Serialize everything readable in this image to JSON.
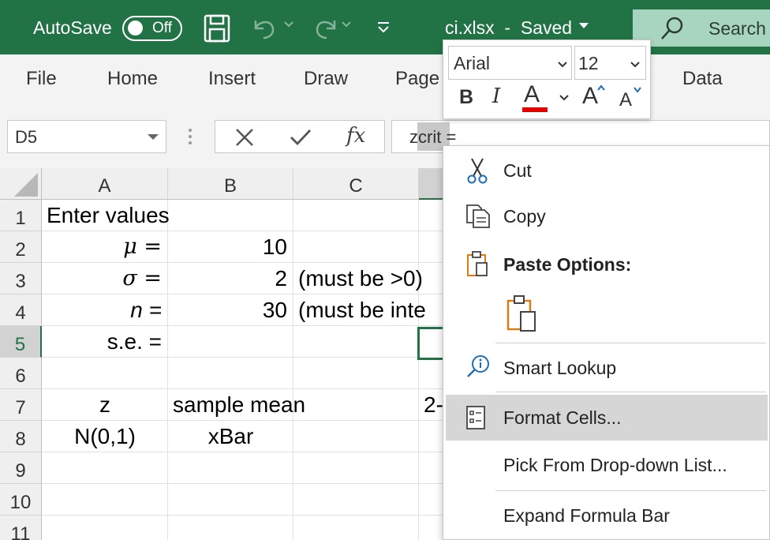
{
  "titlebar": {
    "autosave_label": "AutoSave",
    "autosave_state": "Off",
    "doc_title": "ci.xlsx  -  Saved",
    "search_label": "Search"
  },
  "ribbon": {
    "tabs": [
      "File",
      "Home",
      "Insert",
      "Draw",
      "Page",
      "Data"
    ]
  },
  "formula_bar": {
    "name_box": "D5",
    "fx_label": "fx",
    "formula": "zcrit ="
  },
  "grid": {
    "columns": [
      "A",
      "B",
      "C"
    ],
    "rows": [
      "1",
      "2",
      "3",
      "4",
      "5",
      "6",
      "7",
      "8",
      "9",
      "10",
      "11"
    ],
    "cells": {
      "A1": "Enter values",
      "A2": "μ =",
      "B2": "10",
      "A3": "σ =",
      "B3": "2",
      "C3": "(must be >0)",
      "A4": "n =",
      "B4": "30",
      "C4": "(must be inte",
      "A5": "s.e. =",
      "A7": "z",
      "B7": "sample mean",
      "D7": "2-",
      "A8": "N(0,1)",
      "B8": "xBar"
    }
  },
  "mini_toolbar": {
    "font_name": "Arial",
    "font_size": "12",
    "bold": "B",
    "italic": "I",
    "font_color": "A",
    "grow": "A",
    "shrink": "A",
    "font_color_value": "#e00000"
  },
  "context_menu": {
    "cut": "Cut",
    "copy": "Copy",
    "paste_options": "Paste Options:",
    "smart_lookup": "Smart Lookup",
    "format_cells": "Format Cells...",
    "pick_list": "Pick From Drop-down List...",
    "expand_formula_bar": "Expand Formula Bar"
  },
  "colors": {
    "accent": "#217346",
    "search_bg": "#a8d5bf",
    "menu_hover": "#d6d6d6",
    "paste_icon": "#e07a10",
    "cut_icon": "#1e6fb8"
  }
}
